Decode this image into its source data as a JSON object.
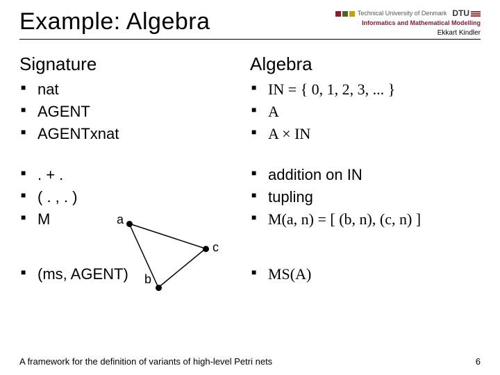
{
  "header": {
    "title": "Example: Algebra",
    "institution_top": "Technical University of Denmark",
    "institution_bottom": "Informatics and Mathematical Modelling",
    "dtu": "DTU",
    "author": "Ekkart Kindler"
  },
  "left": {
    "heading1": "Signature",
    "items1": [
      "nat",
      "AGENT",
      "AGENTxnat"
    ],
    "items2": [
      ". + .",
      "( . , . )",
      "M"
    ],
    "items3": [
      "(ms, AGENT)"
    ]
  },
  "right": {
    "heading1": "Algebra",
    "items1": [
      "IN = { 0, 1, 2, 3, ... }",
      "A",
      "A × IN"
    ],
    "items2": [
      "addition on IN",
      "tupling",
      "M(a, n) = [ (b, n), (c, n) ]"
    ],
    "items3": [
      "MS(A)"
    ]
  },
  "diagram": {
    "a": "a",
    "b": "b",
    "c": "c"
  },
  "footer": {
    "text": "A framework for the definition of variants of high-level Petri nets",
    "page": "6"
  }
}
